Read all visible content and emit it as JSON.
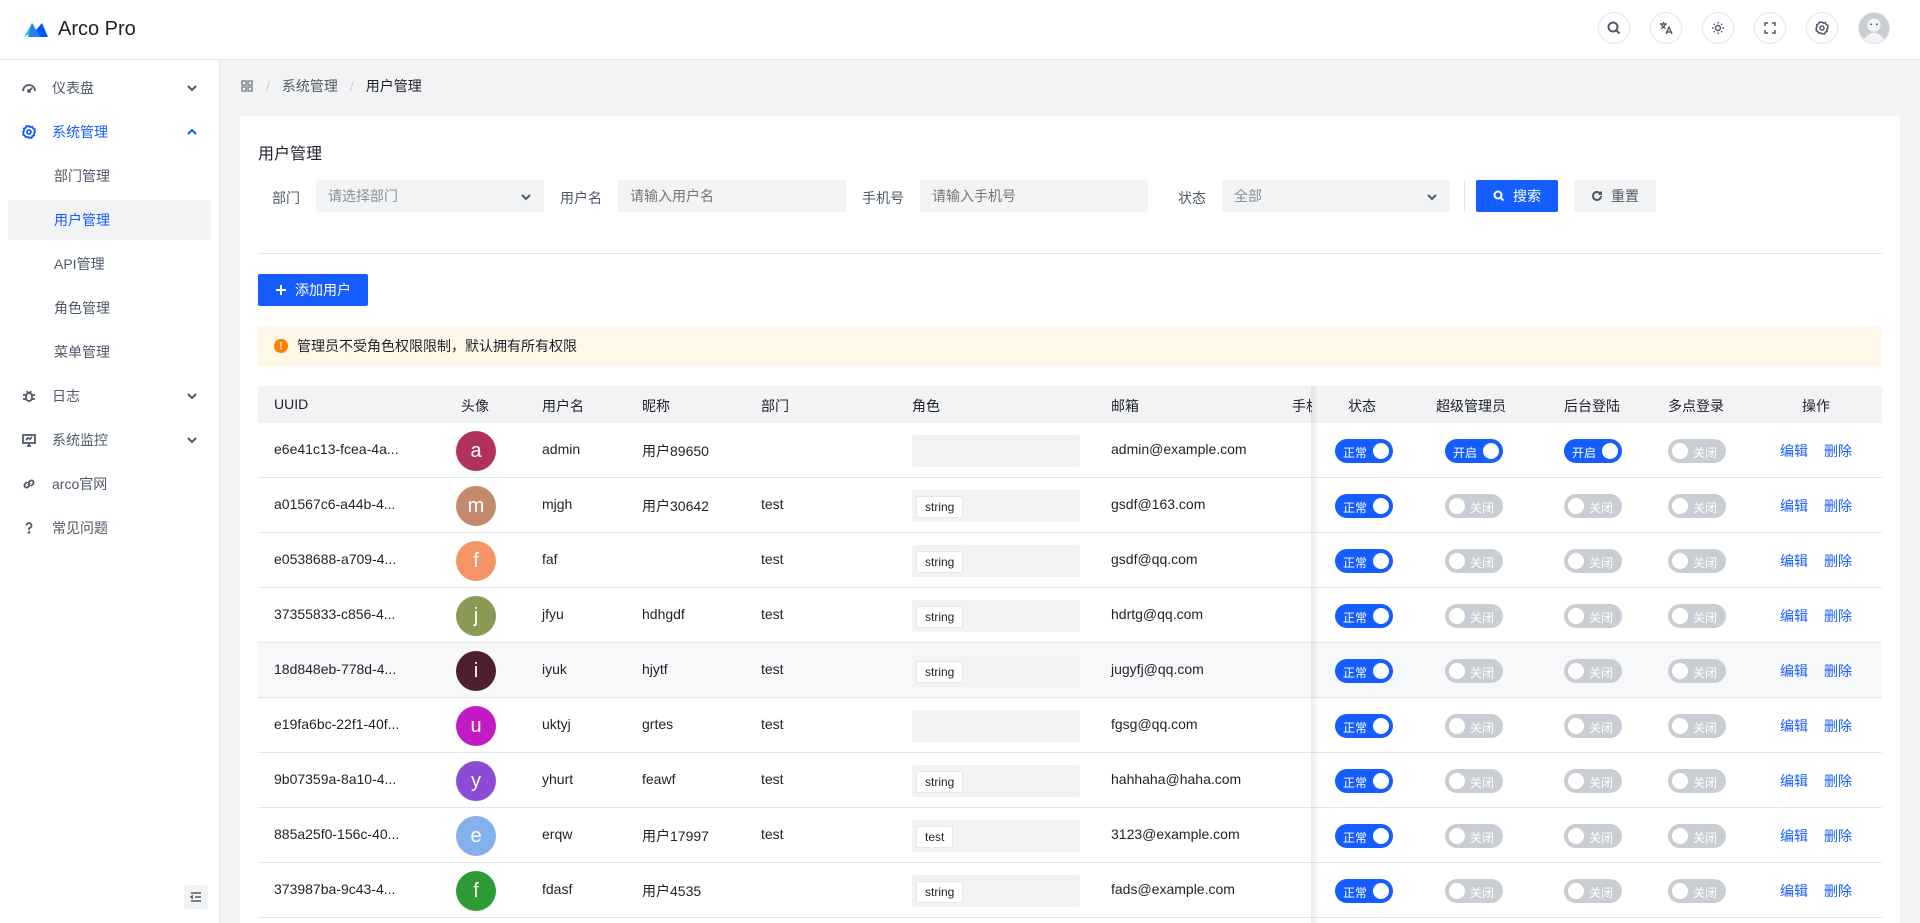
{
  "app": {
    "title": "Arco Pro"
  },
  "sidebar": {
    "items": [
      {
        "label": "仪表盘",
        "icon": "dashboard-icon"
      },
      {
        "label": "系统管理",
        "icon": "gear-icon",
        "open": true,
        "children": [
          {
            "label": "部门管理"
          },
          {
            "label": "用户管理",
            "active": true
          },
          {
            "label": "API管理"
          },
          {
            "label": "角色管理"
          },
          {
            "label": "菜单管理"
          }
        ]
      },
      {
        "label": "日志",
        "icon": "bug-icon"
      },
      {
        "label": "系统监控",
        "icon": "monitor-icon"
      },
      {
        "label": "arco官网",
        "icon": "link-icon"
      },
      {
        "label": "常见问题",
        "icon": "question-icon"
      }
    ]
  },
  "breadcrumb": {
    "items": [
      "系统管理",
      "用户管理"
    ]
  },
  "page": {
    "title": "用户管理"
  },
  "filters": {
    "dept": {
      "label": "部门",
      "placeholder": "请选择部门"
    },
    "username": {
      "label": "用户名",
      "placeholder": "请输入用户名"
    },
    "phone": {
      "label": "手机号",
      "placeholder": "请输入手机号"
    },
    "status": {
      "label": "状态",
      "value": "全部"
    },
    "search_label": "搜索",
    "reset_label": "重置"
  },
  "add_user_label": "添加用户",
  "alert": {
    "text": "管理员不受角色权限限制，默认拥有所有权限"
  },
  "table": {
    "columns": [
      "UUID",
      "头像",
      "用户名",
      "昵称",
      "部门",
      "角色",
      "邮箱",
      "手机",
      "状态",
      "超级管理员",
      "后台登陆",
      "多点登录",
      "操作"
    ],
    "on_text": "开启",
    "off_text": "关闭",
    "status_text": "正常",
    "edit_label": "编辑",
    "delete_label": "删除",
    "rows": [
      {
        "uuid": "e6e41c13-fcea-4a...",
        "avatar": "a",
        "avatar_color": "#b0325a",
        "username": "admin",
        "nickname": "用户89650",
        "dept": "",
        "role": "",
        "email": "admin@example.com",
        "super_admin": true,
        "backend_login": true,
        "multi_login": false
      },
      {
        "uuid": "a01567c6-a44b-4...",
        "avatar": "m",
        "avatar_color": "#c48a6e",
        "username": "mjgh",
        "nickname": "用户30642",
        "dept": "test",
        "role": "string",
        "email": "gsdf@163.com",
        "super_admin": false,
        "backend_login": false,
        "multi_login": false
      },
      {
        "uuid": "e0538688-a709-4...",
        "avatar": "f",
        "avatar_color": "#f49467",
        "username": "faf",
        "nickname": "",
        "dept": "test",
        "role": "string",
        "email": "gsdf@qq.com",
        "super_admin": false,
        "backend_login": false,
        "multi_login": false
      },
      {
        "uuid": "37355833-c856-4...",
        "avatar": "j",
        "avatar_color": "#8a9a54",
        "username": "jfyu",
        "nickname": "hdhgdf",
        "dept": "test",
        "role": "string",
        "email": "hdrtg@qq.com",
        "super_admin": false,
        "backend_login": false,
        "multi_login": false
      },
      {
        "uuid": "18d848eb-778d-4...",
        "avatar": "i",
        "avatar_color": "#4e1f2c",
        "username": "iyuk",
        "nickname": "hjytf",
        "dept": "test",
        "role": "string",
        "email": "jugyfj@qq.com",
        "super_admin": false,
        "backend_login": false,
        "multi_login": false
      },
      {
        "uuid": "e19fa6bc-22f1-40f...",
        "avatar": "u",
        "avatar_color": "#c21bc6",
        "username": "uktyj",
        "nickname": "grtes",
        "dept": "test",
        "role": "",
        "email": "fgsg@qq.com",
        "super_admin": false,
        "backend_login": false,
        "multi_login": false
      },
      {
        "uuid": "9b07359a-8a10-4...",
        "avatar": "y",
        "avatar_color": "#8c4bd4",
        "username": "yhurt",
        "nickname": "feawf",
        "dept": "test",
        "role": "string",
        "email": "hahhaha@haha.com",
        "super_admin": false,
        "backend_login": false,
        "multi_login": false
      },
      {
        "uuid": "885a25f0-156c-40...",
        "avatar": "e",
        "avatar_color": "#84b0ee",
        "username": "erqw",
        "nickname": "用户17997",
        "dept": "test",
        "role": "test",
        "email": "3123@example.com",
        "super_admin": false,
        "backend_login": false,
        "multi_login": false
      },
      {
        "uuid": "373987ba-9c43-4...",
        "avatar": "f",
        "avatar_color": "#2f9b36",
        "username": "fdasf",
        "nickname": "用户4535",
        "dept": "",
        "role": "string",
        "email": "fads@example.com",
        "super_admin": false,
        "backend_login": false,
        "multi_login": false
      }
    ]
  },
  "colors": {
    "primary": "#165dff",
    "warning_bg": "#fff7e8",
    "warning_icon": "#ff7d00"
  }
}
